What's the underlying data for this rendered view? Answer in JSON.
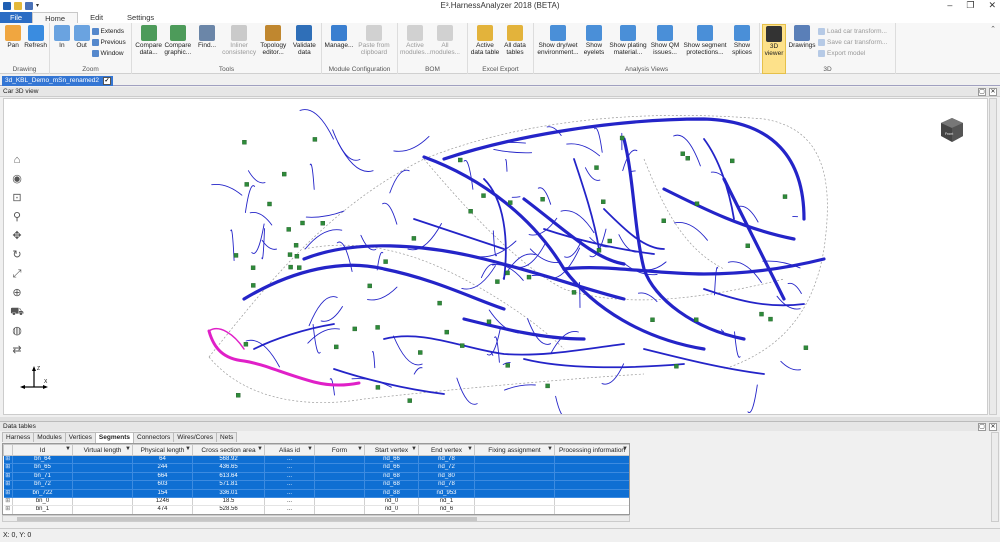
{
  "app": {
    "title": "E³.HarnessAnalyzer 2018 (BETA)"
  },
  "menu": {
    "tabs": [
      {
        "label": "File"
      },
      {
        "label": "Home"
      },
      {
        "label": "Edit"
      },
      {
        "label": "Settings"
      }
    ]
  },
  "ribbon": {
    "groups": [
      {
        "label": "Drawing",
        "buttons": [
          {
            "label": "Pan"
          },
          {
            "label": "Refresh"
          }
        ]
      },
      {
        "label": "Zoom",
        "buttons": [
          {
            "label": "In"
          },
          {
            "label": "Out"
          }
        ],
        "small": [
          "Extends",
          "Previous",
          "Window"
        ]
      },
      {
        "label": "Tools",
        "buttons": [
          {
            "label": "Compare data..."
          },
          {
            "label": "Compare graphic..."
          },
          {
            "label": "Find..."
          },
          {
            "label": "Inliner consistency"
          },
          {
            "label": "Topology editor..."
          },
          {
            "label": "Validate data"
          }
        ]
      },
      {
        "label": "Module Configuration",
        "buttons": [
          {
            "label": "Manage..."
          },
          {
            "label": "Paste from clipboard"
          }
        ]
      },
      {
        "label": "BOM",
        "buttons": [
          {
            "label": "Active modules..."
          },
          {
            "label": "All modules..."
          }
        ]
      },
      {
        "label": "Excel Export",
        "buttons": [
          {
            "label": "Active data table"
          },
          {
            "label": "All data tables"
          }
        ]
      },
      {
        "label": "Analysis Views",
        "buttons": [
          {
            "label": "Show dry/wet environment..."
          },
          {
            "label": "Show eyelets"
          },
          {
            "label": "Show plating material..."
          },
          {
            "label": "Show QM issues..."
          },
          {
            "label": "Show segment protections..."
          },
          {
            "label": "Show splices"
          }
        ]
      },
      {
        "label": "3D",
        "buttons": [
          {
            "label": "3D viewer"
          },
          {
            "label": "Drawings"
          }
        ],
        "small": [
          "Load car transform...",
          "Save car transform...",
          "Export model"
        ]
      }
    ]
  },
  "document": {
    "tab_label": "3d_KBL_Demo_mSn_renamed2",
    "viewer_title": "Car 3D view"
  },
  "data_tables": {
    "title": "Data tables",
    "tabs": [
      "Harness",
      "Modules",
      "Vertices",
      "Segments",
      "Connectors",
      "Wires/Cores",
      "Nets"
    ],
    "active_tab": "Segments",
    "columns": [
      "Id",
      "Virtual length",
      "Physical length",
      "Cross section area",
      "Alias id",
      "Form",
      "Start vertex",
      "End vertex",
      "Fixing assignment",
      "Processing information"
    ],
    "rows": [
      {
        "id": "bn_64",
        "physical_length": "64",
        "cross_section": "568.92",
        "alias": "...",
        "start": "nd_66",
        "end": "nd_78",
        "selected": true
      },
      {
        "id": "bn_65",
        "physical_length": "244",
        "cross_section": "436.65",
        "alias": "...",
        "start": "nd_66",
        "end": "nd_72",
        "selected": true
      },
      {
        "id": "bn_71",
        "physical_length": "664",
        "cross_section": "613.64",
        "alias": "...",
        "start": "nd_68",
        "end": "nd_80",
        "selected": true
      },
      {
        "id": "bn_72",
        "physical_length": "603",
        "cross_section": "571.81",
        "alias": "...",
        "start": "nd_68",
        "end": "nd_78",
        "selected": true
      },
      {
        "id": "bn_722",
        "physical_length": "154",
        "cross_section": "336.01",
        "alias": "...",
        "start": "nd_88",
        "end": "nd_953",
        "selected": true
      },
      {
        "id": "bn_0",
        "physical_length": "1246",
        "cross_section": "18.5",
        "alias": "...",
        "start": "nd_0",
        "end": "nd_1",
        "selected": false
      },
      {
        "id": "bn_1",
        "physical_length": "474",
        "cross_section": "528.56",
        "alias": "...",
        "start": "nd_0",
        "end": "nd_6",
        "selected": false
      }
    ]
  },
  "status": {
    "coords": "X: 0, Y: 0"
  },
  "colors": {
    "wire": "#2424c8",
    "highlight": "#e020c8",
    "connector": "#2e8b3a",
    "selection": "#0f6fd3",
    "file_tab": "#2b6cc4"
  },
  "icons": {
    "qa": [
      "app-icon",
      "open-icon",
      "save-icon",
      "dropdown-icon"
    ],
    "nav": [
      "home-icon",
      "look-icon",
      "zoom-window-icon",
      "zoom-icon",
      "pan-icon",
      "rotate-icon",
      "fit-icon",
      "orbit-icon",
      "car-icon",
      "sphere-icon",
      "swap-icon"
    ]
  }
}
